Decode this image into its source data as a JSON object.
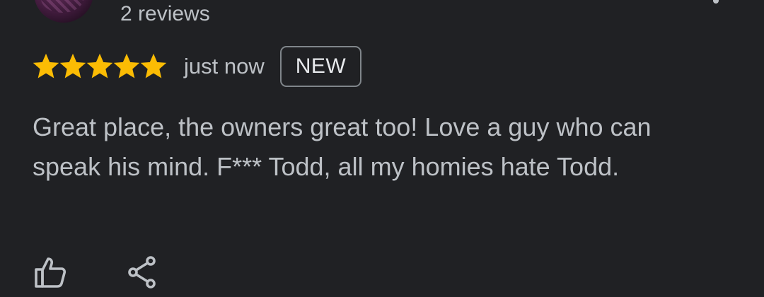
{
  "author": {
    "review_count": "2 reviews"
  },
  "review": {
    "rating": 5,
    "rating_max": 5,
    "time": "just now",
    "badge": "NEW",
    "text": "Great place, the owners great too! Love a guy who can speak his mind. F*** Todd, all my homies hate Todd."
  },
  "actions": {
    "like_icon": "thumbs-up-icon",
    "share_icon": "share-icon"
  },
  "colors": {
    "background": "#202124",
    "star": "#fbbc04",
    "text": "#bdc1c6",
    "badge_border": "#80868b"
  }
}
